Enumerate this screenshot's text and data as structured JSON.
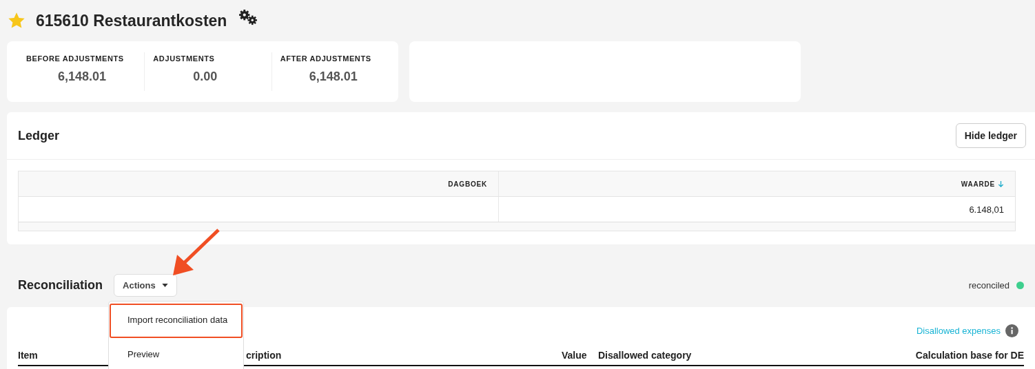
{
  "header": {
    "title": "615610 Restaurantkosten",
    "favorite": true
  },
  "summary": [
    {
      "label": "BEFORE ADJUSTMENTS",
      "value": "6,148.01"
    },
    {
      "label": "ADJUSTMENTS",
      "value": "0.00"
    },
    {
      "label": "AFTER ADJUSTMENTS",
      "value": "6,148.01"
    }
  ],
  "ledger": {
    "title": "Ledger",
    "button": "Hide ledger",
    "columns": [
      {
        "label": "DAGBOEK",
        "sorted": false
      },
      {
        "label": "WAARDE",
        "sorted": true
      }
    ],
    "rows": [
      [
        "",
        "6.148,01"
      ]
    ]
  },
  "reconciliation": {
    "title": "Reconciliation",
    "actions_button": "Actions",
    "menu": [
      {
        "label": "Import reconciliation data",
        "highlighted": true
      },
      {
        "label": "Preview",
        "highlighted": false
      }
    ],
    "status": {
      "label": "reconciled",
      "color": "#3ecf8e"
    },
    "link": "Disallowed expenses",
    "columns": [
      "Item",
      "cription",
      "Value",
      "Disallowed category",
      "Calculation base for DE"
    ]
  }
}
